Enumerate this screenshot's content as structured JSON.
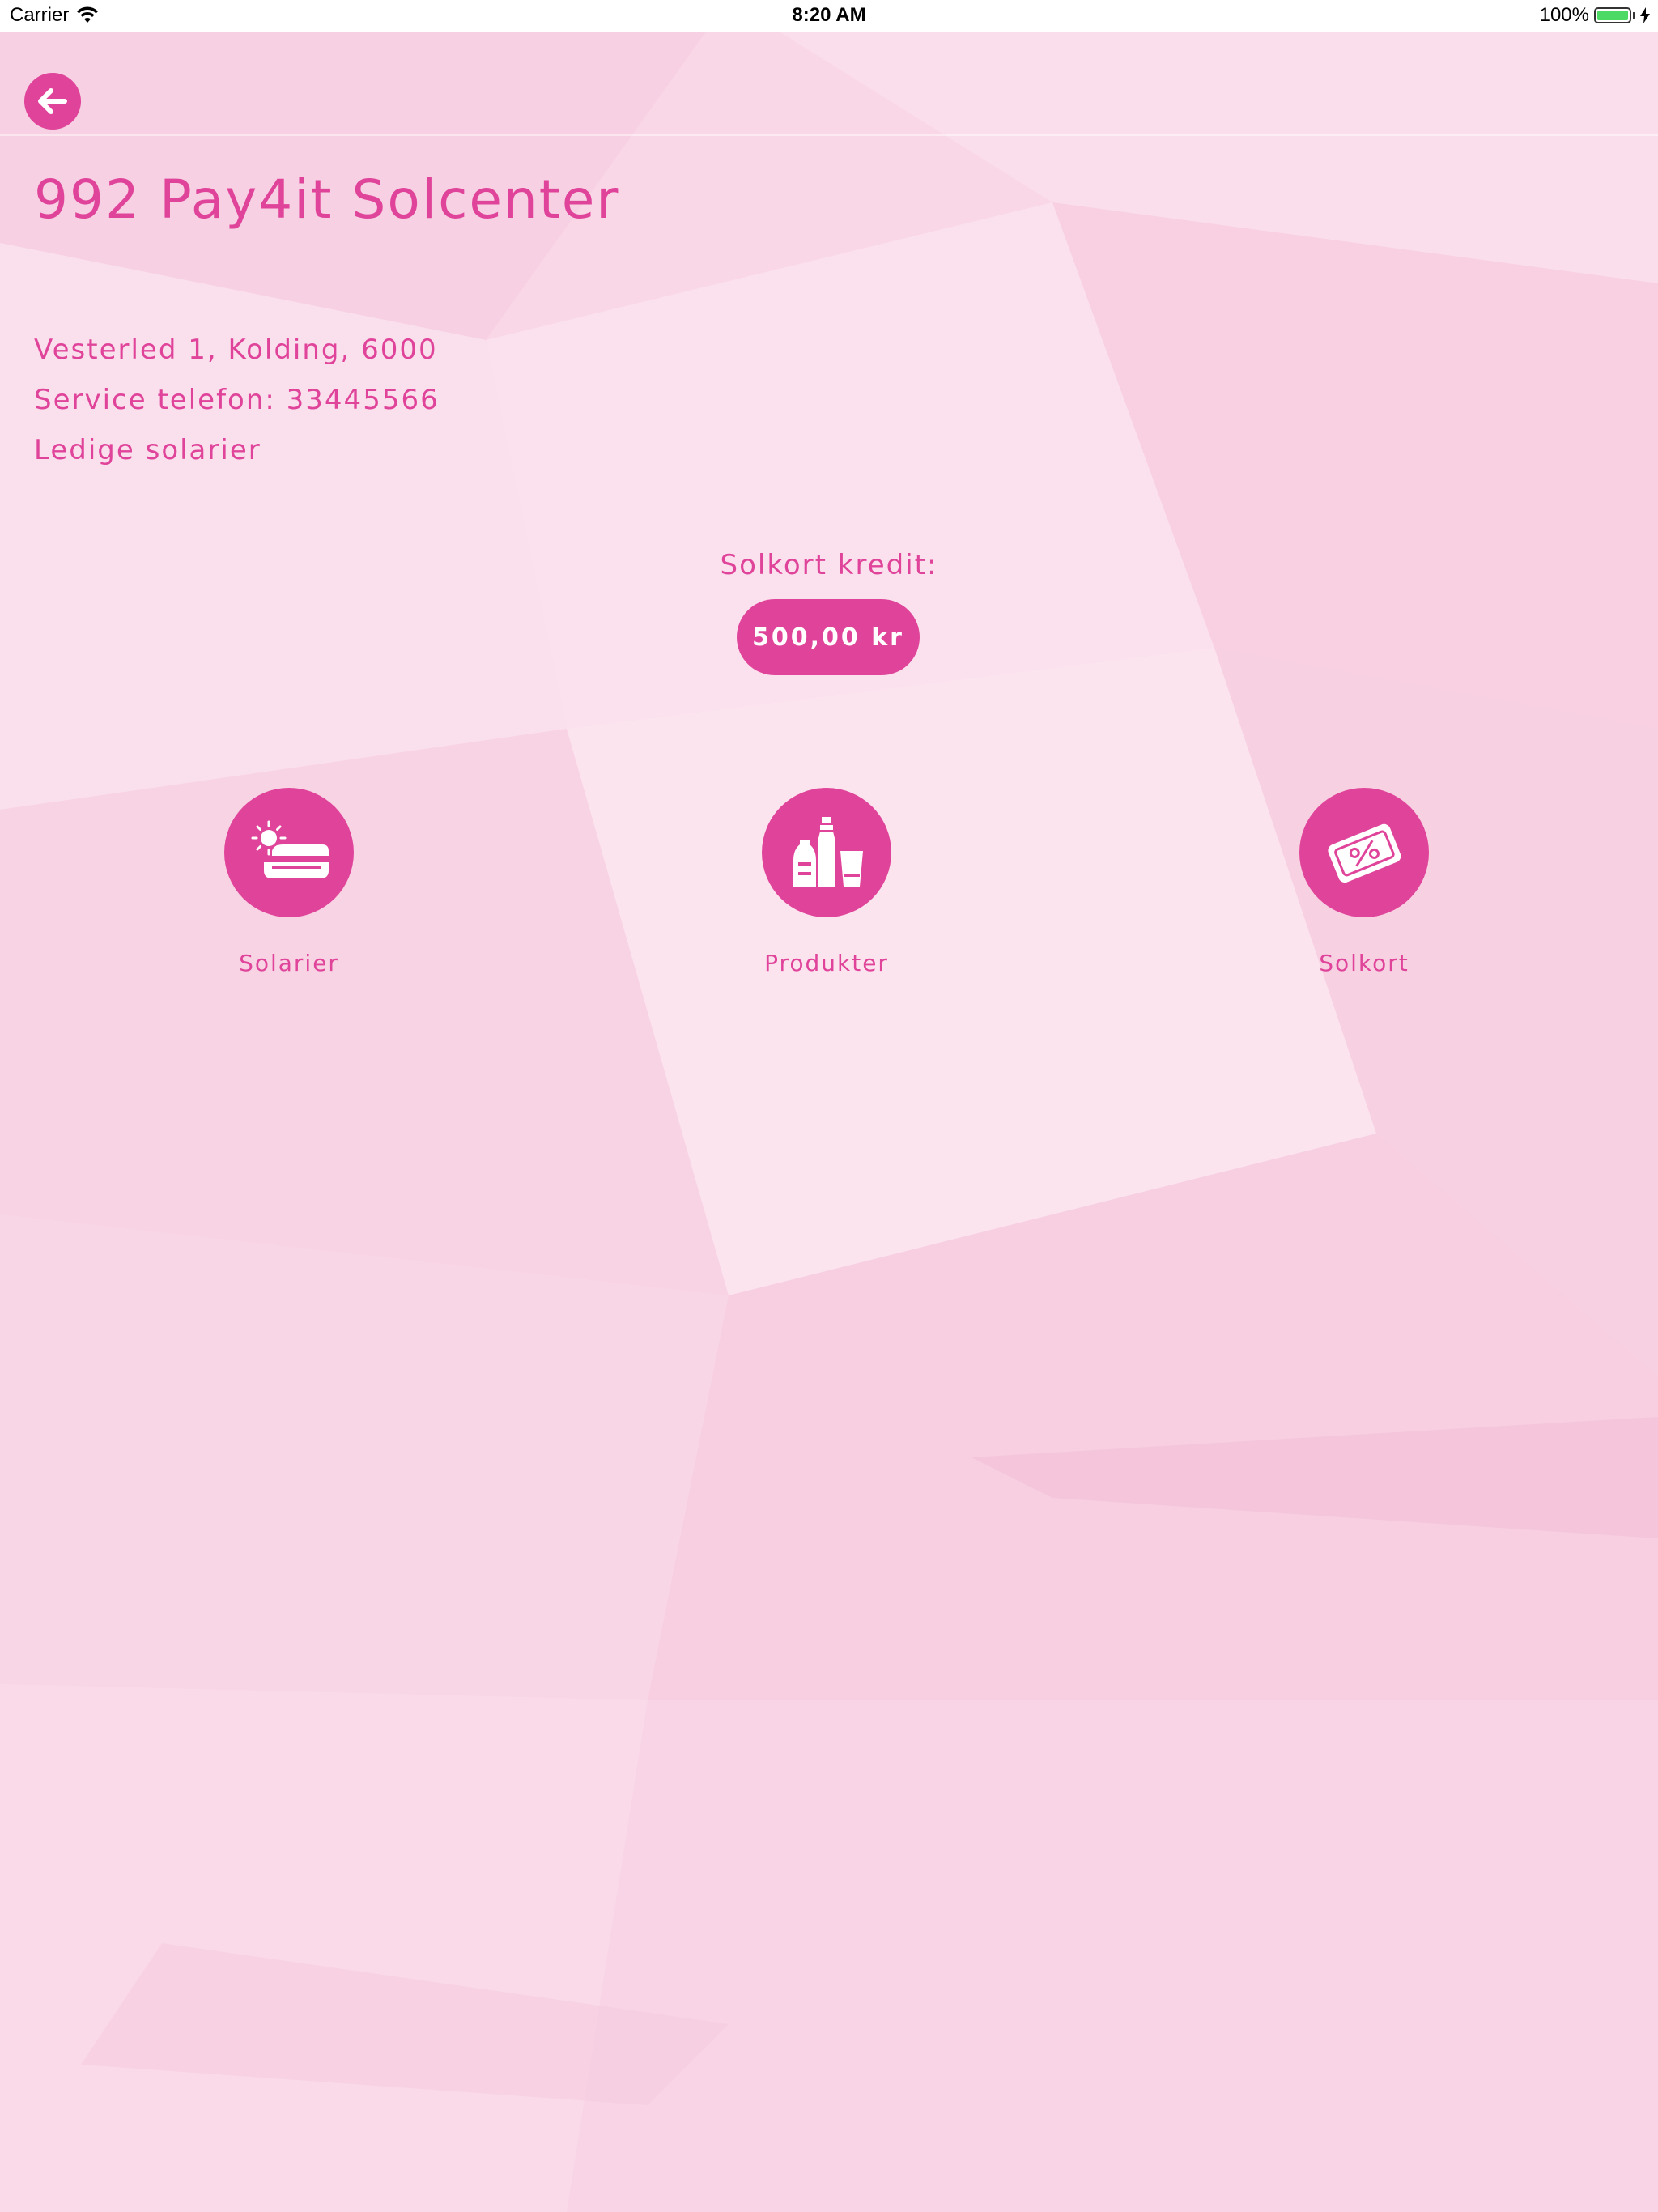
{
  "status_bar": {
    "carrier": "Carrier",
    "time": "8:20 AM",
    "battery": "100%"
  },
  "header": {
    "title": "992 Pay4it Solcenter"
  },
  "info": {
    "address": "Vesterled 1, Kolding, 6000",
    "phone": "Service telefon: 33445566",
    "available": "Ledige solarier"
  },
  "credit": {
    "label": "Solkort kredit:",
    "value": "500,00 kr"
  },
  "actions": [
    {
      "label": "Solarier",
      "icon": "tanning-bed-icon"
    },
    {
      "label": "Produkter",
      "icon": "products-icon"
    },
    {
      "label": "Solkort",
      "icon": "card-icon"
    }
  ],
  "colors": {
    "accent": "#e0449a",
    "background": "#f9d6e6"
  }
}
